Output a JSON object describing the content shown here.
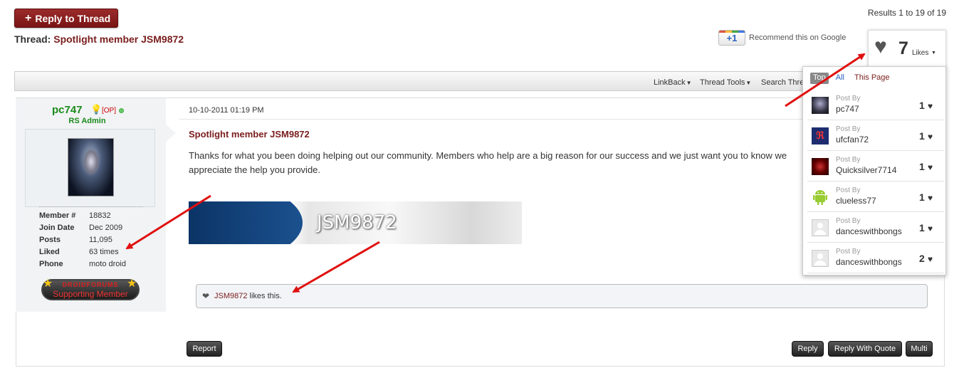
{
  "header": {
    "reply_button": "Reply to Thread",
    "results": "Results 1 to 19 of 19",
    "thread_label": "Thread:",
    "thread_title": "Spotlight member JSM9872",
    "gplus_label": "+1",
    "recommend": "Recommend this on Google"
  },
  "likes_panel": {
    "count": "7",
    "label": "Likes",
    "tabs": [
      "Top",
      "All",
      "This Page"
    ],
    "post_by_label": "Post By",
    "items": [
      {
        "name": "pc747",
        "count": "1"
      },
      {
        "name": "ufcfan72",
        "count": "1"
      },
      {
        "name": "Quicksilver7714",
        "count": "1"
      },
      {
        "name": "clueless77",
        "count": "1"
      },
      {
        "name": "danceswithbongs",
        "count": "1"
      },
      {
        "name": "danceswithbongs",
        "count": "2"
      }
    ]
  },
  "toolbar": {
    "linkback": "LinkBack",
    "thread_tools": "Thread Tools",
    "search_thread": "Search Thre"
  },
  "user": {
    "name": "pc747",
    "op_tag": "[OP]",
    "title": "RS Admin",
    "stats": [
      {
        "label": "Member #",
        "value": "18832"
      },
      {
        "label": "Join Date",
        "value": "Dec 2009"
      },
      {
        "label": "Posts",
        "value": "11,095"
      },
      {
        "label": "Liked",
        "value": "63 times"
      },
      {
        "label": "Phone",
        "value": "moto droid"
      }
    ],
    "badge_top": "DROIDFORUMS",
    "badge_bottom": "Supporting Member"
  },
  "post": {
    "date": "10-10-2011 01:19 PM",
    "title": "Spotlight member JSM9872",
    "body": "Thanks for what you been doing helping out our community. Members who help are a big reason for our success and we just want you to know we appreciate the help you provide.",
    "signature": "JSM9872",
    "liker": "JSM9872",
    "likes_suffix": " likes this."
  },
  "actions": {
    "report": "Report",
    "reply": "Reply",
    "reply_quote": "Reply With Quote",
    "multi": "Multi"
  },
  "colors": {
    "brand_red": "#7a1d1d",
    "admin_green": "#1a8a1a",
    "annotation_arrow": "#e01010"
  }
}
